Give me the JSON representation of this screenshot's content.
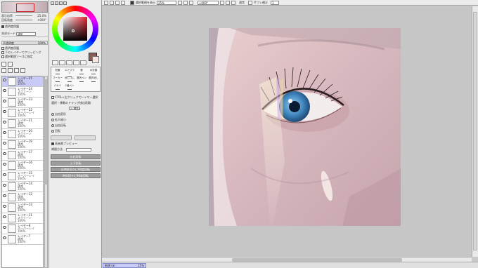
{
  "navigator": {
    "zoom_label": "表示倍率",
    "zoom_value": "25.0%",
    "angle_label": "回転角度",
    "angle_value": "+000°",
    "protect_label": "透明度保護",
    "clip_label": "下のレイヤーでクリッピング",
    "select_source_label": "選択範囲ソースに指定",
    "mode_label": "合成モード",
    "mode_value": "通常",
    "opacity_label": "不透明度",
    "opacity_value": "100%"
  },
  "layers": [
    {
      "name": "レイヤー25",
      "mode": "通常",
      "opacity": "100%",
      "selected": true
    },
    {
      "name": "レイヤー24",
      "mode": "スクリーン",
      "opacity": "100%",
      "selected": false
    },
    {
      "name": "レイヤー23",
      "mode": "通常",
      "opacity": "100%",
      "selected": false
    },
    {
      "name": "レイヤー22",
      "mode": "オーバーレイ",
      "opacity": "100%",
      "selected": false
    },
    {
      "name": "レイヤー21",
      "mode": "通常",
      "opacity": "100%",
      "selected": false
    },
    {
      "name": "レイヤー20",
      "mode": "スクリーン",
      "opacity": "100%",
      "selected": false
    },
    {
      "name": "レイヤー19",
      "mode": "通常",
      "opacity": "100%",
      "selected": false
    },
    {
      "name": "レイヤー17",
      "mode": "通常",
      "opacity": "100%",
      "selected": false
    },
    {
      "name": "レイヤー16",
      "mode": "通常",
      "opacity": "100%",
      "selected": false
    },
    {
      "name": "レイヤー15",
      "mode": "オーバーレイ",
      "opacity": "100%",
      "selected": false
    },
    {
      "name": "レイヤー14",
      "mode": "通常",
      "opacity": "100%",
      "selected": false
    },
    {
      "name": "レイヤー12",
      "mode": "通常",
      "opacity": "100%",
      "selected": false
    },
    {
      "name": "レイヤー13",
      "mode": "通常",
      "opacity": "100%",
      "selected": false
    },
    {
      "name": "レイヤー11",
      "mode": "スクリーン",
      "opacity": "100%",
      "selected": false
    },
    {
      "name": "レイヤー8",
      "mode": "オーバーレイ",
      "opacity": "100%",
      "selected": false
    },
    {
      "name": "レイヤー7",
      "mode": "通常",
      "opacity": "100%",
      "selected": false
    }
  ],
  "colors": {
    "foreground": "#8a5c58",
    "background": "#f6e6e3"
  },
  "brushes": [
    {
      "label": "鉛筆"
    },
    {
      "label": "エアブラシ"
    },
    {
      "label": "筆"
    },
    {
      "label": "水彩筆"
    },
    {
      "label": "マーカー"
    },
    {
      "label": "消しゴム"
    },
    {
      "label": "選択ペン"
    },
    {
      "label": "選択消し"
    },
    {
      "label": "バケツ"
    },
    {
      "label": "2値ペン"
    }
  ],
  "options": {
    "ctrl_select": "CTRL+左クリックでレイヤー選択",
    "drag_threshold": "選択・移動のドラッグ検出距離",
    "drag_value": "2 (標準)",
    "free_transform": "自由変形",
    "scale": "拡大縮小",
    "free_rotate": "自由回転",
    "rotate": "回転",
    "hq_preview": "高画質プレビュー",
    "interp_label": "補間方法"
  },
  "buttons": {
    "flip_h": "左右反転",
    "flip_v": "上下反転",
    "rotate_ccw": "反時計回りに90度回転",
    "rotate_cw": "時計回りに90度回転"
  },
  "toolbar": {
    "show_selection": "選択範囲を表示",
    "zoom": "25%",
    "angle": "+000°",
    "mode": "通常",
    "stabilizer_label": "手ブレ補正",
    "stabilizer_value": "3"
  },
  "status": {
    "doc_name": "新規 (a)",
    "doc_zoom": "25%"
  }
}
